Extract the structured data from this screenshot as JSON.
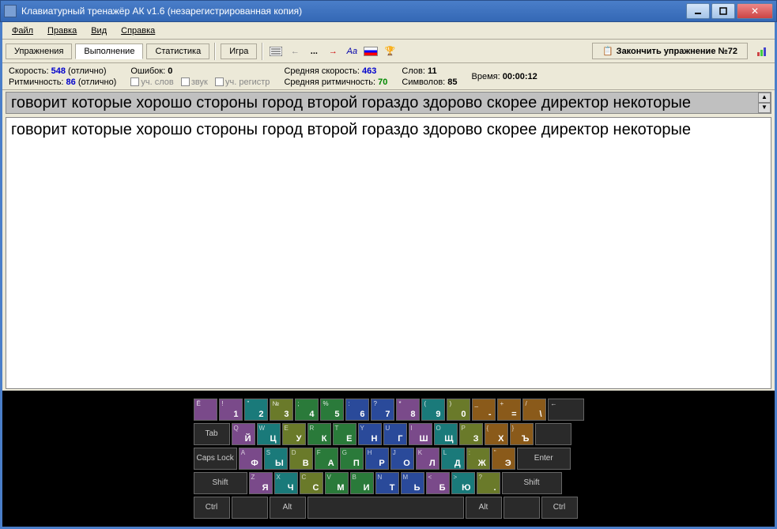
{
  "window": {
    "title": "Клавиатурный тренажёр АК v1.6  (незарегистрированная копия)"
  },
  "menu": {
    "file": "Файл",
    "edit": "Правка",
    "view": "Вид",
    "help": "Справка"
  },
  "tabs": {
    "exercises": "Упражнения",
    "execution": "Выполнение",
    "statistics": "Статистика",
    "game": "Игра"
  },
  "toolbar": {
    "dots": "...",
    "aa": "Aa",
    "finish": "Закончить упражнение №72"
  },
  "stats": {
    "speed_label": "Скорость:",
    "speed_val": "548",
    "speed_note": "(отлично)",
    "rhythm_label": "Ритмичность:",
    "rhythm_val": "86",
    "rhythm_note": "(отлично)",
    "errors_label": "Ошибок:",
    "errors_val": "0",
    "chk_words": "уч. слов",
    "chk_sound": "звук",
    "chk_case": "уч. регистр",
    "avg_speed_label": "Средняя скорость:",
    "avg_speed_val": "463",
    "avg_rhythm_label": "Средняя ритмичность:",
    "avg_rhythm_val": "70",
    "words_label": "Слов:",
    "words_val": "11",
    "chars_label": "Символов:",
    "chars_val": "85",
    "time_label": "Время:",
    "time_val": "00:00:12"
  },
  "text": {
    "target": "говорит которые хорошо стороны город второй гораздо здорово скорее директор некоторые",
    "typed": "говорит которые хорошо стороны город второй гораздо здорово скорее директор некоторые"
  },
  "keyboard": {
    "row1": [
      {
        "t": "Ё",
        "c": "c-purple"
      },
      {
        "t": "!",
        "m": "1",
        "c": "c-purple"
      },
      {
        "t": "\"",
        "m": "2",
        "c": "c-teal"
      },
      {
        "t": "№",
        "m": "3",
        "c": "c-olive"
      },
      {
        "t": ";",
        "m": "4",
        "c": "c-green"
      },
      {
        "t": "%",
        "m": "5",
        "c": "c-green"
      },
      {
        "t": ":",
        "m": "6",
        "c": "c-blue"
      },
      {
        "t": "?",
        "m": "7",
        "c": "c-blue"
      },
      {
        "t": "*",
        "m": "8",
        "c": "c-purple"
      },
      {
        "t": "(",
        "m": "9",
        "c": "c-teal"
      },
      {
        "t": ")",
        "m": "0",
        "c": "c-olive"
      },
      {
        "t": "_",
        "m": "-",
        "c": "c-orange"
      },
      {
        "t": "+",
        "m": "=",
        "c": "c-orange"
      },
      {
        "t": "/",
        "m": "\\",
        "c": "c-orange"
      },
      {
        "t": "←",
        "c": "c-dark",
        "w": "wide1"
      }
    ],
    "row2_tab": "Tab",
    "row2": [
      {
        "l": "Q",
        "m": "Й",
        "c": "c-purple"
      },
      {
        "l": "W",
        "m": "Ц",
        "c": "c-teal"
      },
      {
        "l": "E",
        "m": "У",
        "c": "c-olive"
      },
      {
        "l": "R",
        "m": "К",
        "c": "c-green"
      },
      {
        "l": "T",
        "m": "Е",
        "c": "c-green"
      },
      {
        "l": "Y",
        "m": "Н",
        "c": "c-blue"
      },
      {
        "l": "U",
        "m": "Г",
        "c": "c-blue"
      },
      {
        "l": "I",
        "m": "Ш",
        "c": "c-purple"
      },
      {
        "l": "O",
        "m": "Щ",
        "c": "c-teal"
      },
      {
        "l": "P",
        "m": "З",
        "c": "c-olive"
      },
      {
        "l": "{",
        "m": "Х",
        "c": "c-orange"
      },
      {
        "l": "}",
        "m": "Ъ",
        "c": "c-orange"
      }
    ],
    "row3_caps": "Caps Lock",
    "row3": [
      {
        "l": "A",
        "m": "Ф",
        "c": "c-purple"
      },
      {
        "l": "S",
        "m": "Ы",
        "c": "c-teal"
      },
      {
        "l": "D",
        "m": "В",
        "c": "c-olive"
      },
      {
        "l": "F",
        "m": "А",
        "c": "c-green"
      },
      {
        "l": "G",
        "m": "П",
        "c": "c-green"
      },
      {
        "l": "H",
        "m": "Р",
        "c": "c-blue"
      },
      {
        "l": "J",
        "m": "О",
        "c": "c-blue"
      },
      {
        "l": "K",
        "m": "Л",
        "c": "c-purple"
      },
      {
        "l": "L",
        "m": "Д",
        "c": "c-teal"
      },
      {
        "l": ":",
        "m": "Ж",
        "c": "c-olive"
      },
      {
        "l": "\"",
        "m": "Э",
        "c": "c-orange"
      }
    ],
    "row3_enter": "Enter",
    "row4_shift": "Shift",
    "row4": [
      {
        "l": "Z",
        "m": "Я",
        "c": "c-purple"
      },
      {
        "l": "X",
        "m": "Ч",
        "c": "c-teal"
      },
      {
        "l": "C",
        "m": "С",
        "c": "c-olive"
      },
      {
        "l": "V",
        "m": "М",
        "c": "c-green"
      },
      {
        "l": "B",
        "m": "И",
        "c": "c-green"
      },
      {
        "l": "N",
        "m": "Т",
        "c": "c-blue"
      },
      {
        "l": "M",
        "m": "Ь",
        "c": "c-blue"
      },
      {
        "l": "<",
        "m": "Б",
        "c": "c-purple"
      },
      {
        "l": ">",
        "m": "Ю",
        "c": "c-teal"
      },
      {
        "l": "?",
        "m": ".",
        "c": "c-olive"
      }
    ],
    "row5": {
      "ctrl": "Ctrl",
      "alt": "Alt"
    }
  }
}
